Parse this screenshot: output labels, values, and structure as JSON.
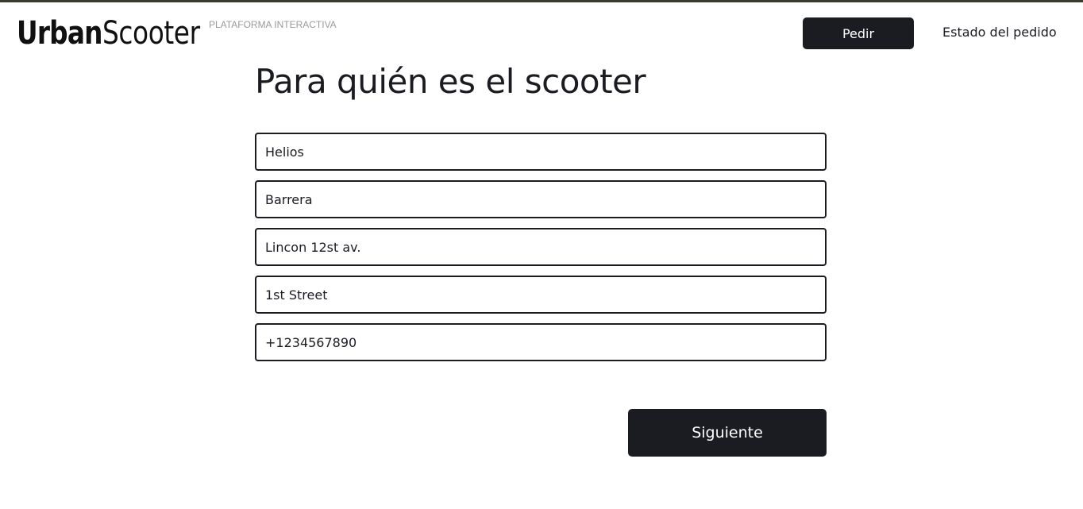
{
  "header": {
    "logo_primary": "Urban",
    "logo_secondary": "Scooter",
    "logo_tagline": "PLATAFORMA INTERACTIVA",
    "order_button": "Pedir",
    "order_status_link": "Estado del pedido"
  },
  "form": {
    "title": "Para quién es el scooter",
    "fields": [
      {
        "value": "Helios"
      },
      {
        "value": "Barrera"
      },
      {
        "value": "Lincon 12st av."
      },
      {
        "value": "1st Street"
      },
      {
        "value": "+1234567890"
      }
    ],
    "next_button": "Siguiente"
  },
  "colors": {
    "dark": "#1b1c22",
    "tagline": "#9a9a9a",
    "background": "#ffffff"
  }
}
